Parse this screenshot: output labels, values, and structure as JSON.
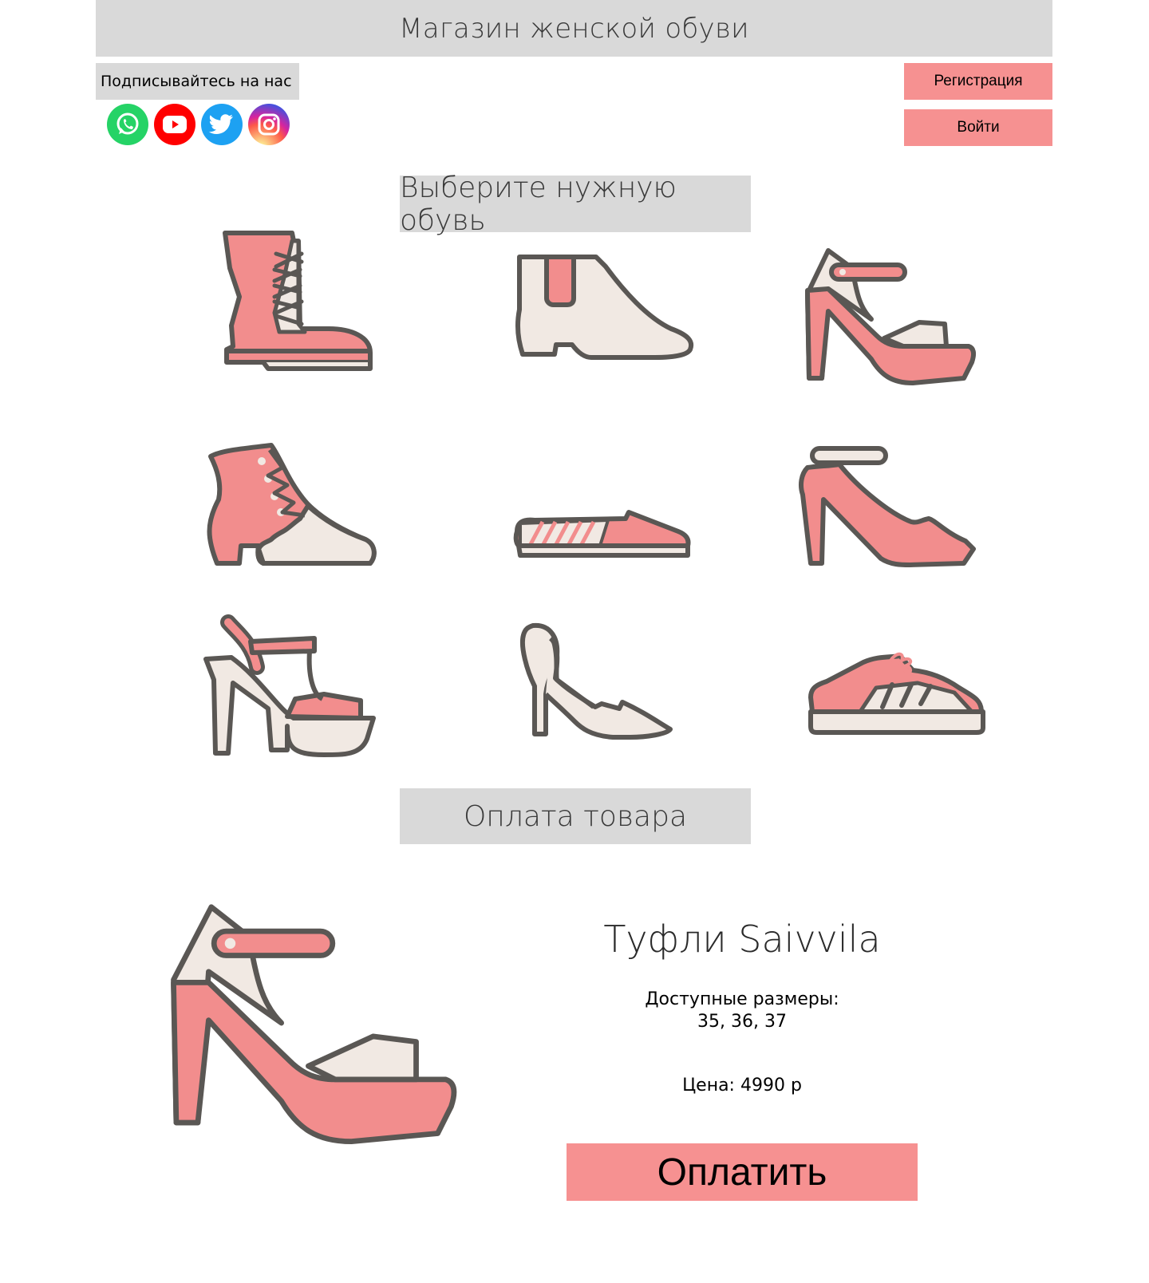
{
  "header": {
    "title": "Магазин женской обуви"
  },
  "social": {
    "label": "Подписывайтесь на нас",
    "icons": [
      "whatsapp-icon",
      "youtube-icon",
      "twitter-icon",
      "instagram-icon"
    ]
  },
  "auth": {
    "register_label": "Регистрация",
    "login_label": "Войти"
  },
  "catalog": {
    "title": "Выберите нужную обувь",
    "items": [
      "lace-up-boot",
      "chelsea-boot",
      "platform-sandal",
      "victorian-bootie",
      "espadrille",
      "ankle-strap-pump",
      "t-strap-platform",
      "dorsay-heel",
      "sneaker"
    ]
  },
  "payment": {
    "title": "Оплата товара",
    "product_name": "Туфли Saivvila",
    "sizes_label": "Доступные размеры:",
    "sizes_value": "35, 36, 37",
    "price": "Цена: 4990 р",
    "pay_label": "Оплатить"
  },
  "colors": {
    "accent": "#f69191",
    "panel": "#d9d9d9",
    "shoe_pink": "#f28d8d",
    "shoe_cream": "#f1e9e3",
    "outline": "#5a5754"
  }
}
